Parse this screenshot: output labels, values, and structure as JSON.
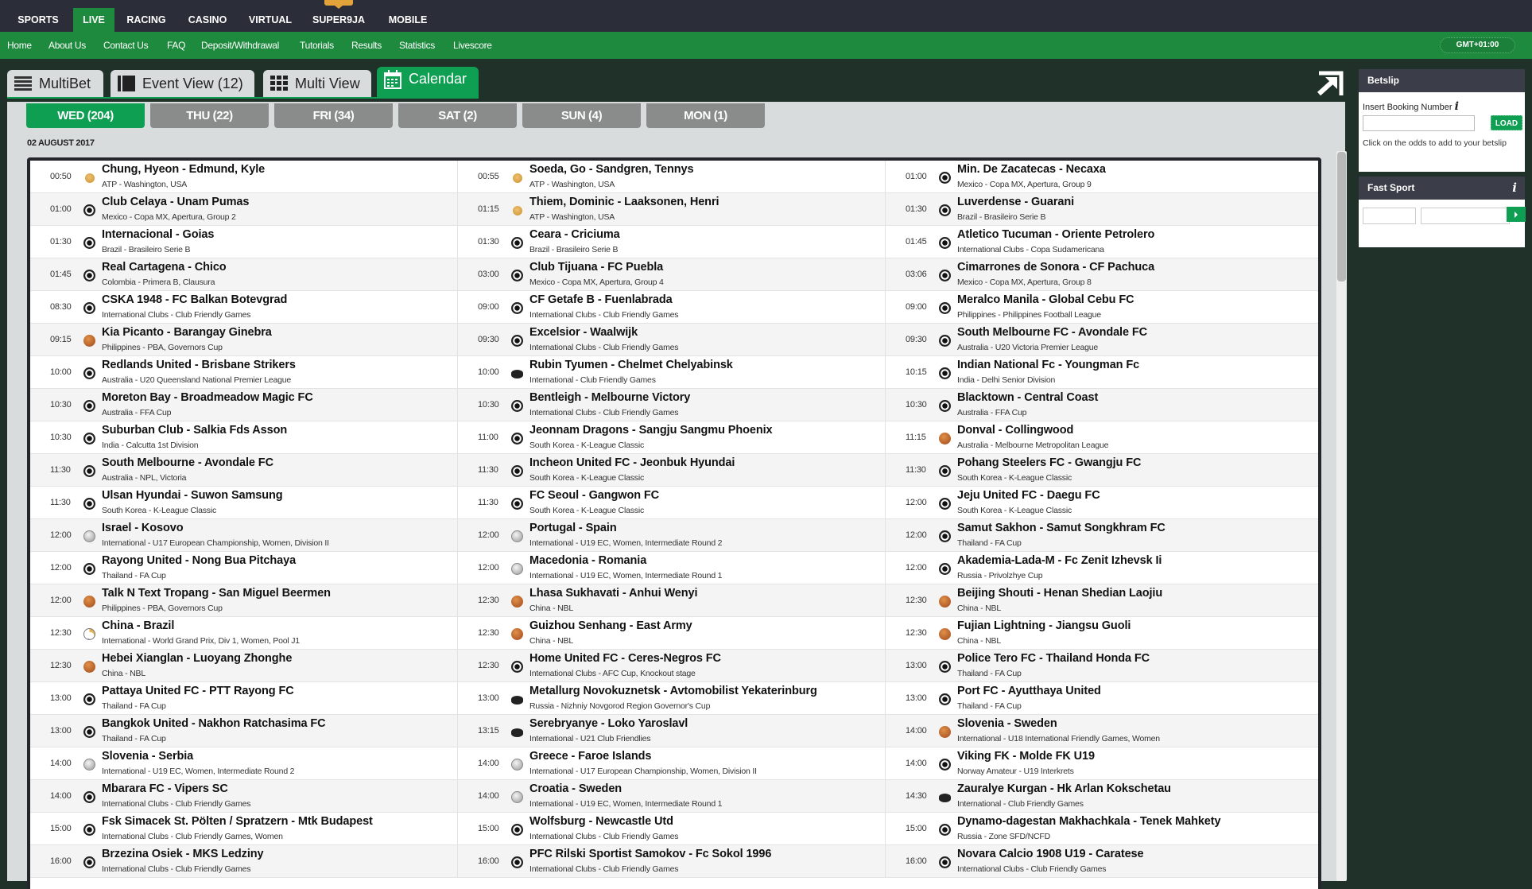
{
  "top_nav": [
    {
      "label": "SPORTS",
      "active": false
    },
    {
      "label": "LIVE",
      "active": true
    },
    {
      "label": "RACING",
      "active": false
    },
    {
      "label": "CASINO",
      "active": false
    },
    {
      "label": "VIRTUAL",
      "active": false
    },
    {
      "label": "SUPER9JA",
      "active": false
    },
    {
      "label": "MOBILE",
      "active": false
    }
  ],
  "sub_nav": [
    "Home",
    "About Us",
    "Contact Us",
    "FAQ",
    "Deposit/Withdrawal",
    "Tutorials",
    "Results",
    "Statistics",
    "Livescore"
  ],
  "timezone": "GMT+01:00",
  "view_tabs": [
    {
      "label": "MultiBet",
      "icon": "list-icon",
      "active": false
    },
    {
      "label": "Event View (12)",
      "icon": "sidebar-layout-icon",
      "active": false
    },
    {
      "label": "Multi View",
      "icon": "grid-icon",
      "active": false
    },
    {
      "label": "Calendar",
      "icon": "calendar-icon",
      "active": true
    }
  ],
  "day_tabs": [
    {
      "label": "WED (204)",
      "active": true
    },
    {
      "label": "THU (22)",
      "active": false
    },
    {
      "label": "FRI (34)",
      "active": false
    },
    {
      "label": "SAT (2)",
      "active": false
    },
    {
      "label": "SUN (4)",
      "active": false
    },
    {
      "label": "MON (1)",
      "active": false
    }
  ],
  "date_label": "02 AUGUST 2017",
  "columns": [
    [
      {
        "time": "00:50",
        "sport": "tennis",
        "match": "Chung, Hyeon - Edmund, Kyle",
        "competition": "ATP - Washington, USA"
      },
      {
        "time": "01:00",
        "sport": "soccer",
        "match": "Club Celaya - Unam Pumas",
        "competition": "Mexico - Copa MX, Apertura, Group 2"
      },
      {
        "time": "01:30",
        "sport": "soccer",
        "match": "Internacional - Goias",
        "competition": "Brazil - Brasileiro Serie B"
      },
      {
        "time": "01:45",
        "sport": "soccer",
        "match": "Real Cartagena - Chico",
        "competition": "Colombia - Primera B, Clausura"
      },
      {
        "time": "08:30",
        "sport": "soccer",
        "match": "CSKA 1948 - FC Balkan Botevgrad",
        "competition": "International Clubs - Club Friendly Games"
      },
      {
        "time": "09:15",
        "sport": "basketball",
        "match": "Kia Picanto - Barangay Ginebra",
        "competition": "Philippines - PBA, Governors Cup"
      },
      {
        "time": "10:00",
        "sport": "soccer",
        "match": "Redlands United - Brisbane Strikers",
        "competition": "Australia - U20 Queensland National Premier League"
      },
      {
        "time": "10:30",
        "sport": "soccer",
        "match": "Moreton Bay - Broadmeadow Magic FC",
        "competition": "Australia - FFA Cup"
      },
      {
        "time": "10:30",
        "sport": "soccer",
        "match": "Suburban Club - Salkia Fds Asson",
        "competition": "India - Calcutta 1st Division"
      },
      {
        "time": "11:30",
        "sport": "soccer",
        "match": "South Melbourne - Avondale FC",
        "competition": "Australia - NPL, Victoria"
      },
      {
        "time": "11:30",
        "sport": "soccer",
        "match": "Ulsan Hyundai - Suwon Samsung",
        "competition": "South Korea - K-League Classic"
      },
      {
        "time": "12:00",
        "sport": "handball",
        "match": "Israel - Kosovo",
        "competition": "International - U17 European Championship, Women, Division II"
      },
      {
        "time": "12:00",
        "sport": "soccer",
        "match": "Rayong United - Nong Bua Pitchaya",
        "competition": "Thailand - FA Cup"
      },
      {
        "time": "12:00",
        "sport": "basketball",
        "match": "Talk N Text Tropang - San Miguel Beermen",
        "competition": "Philippines - PBA, Governors Cup"
      },
      {
        "time": "12:30",
        "sport": "volleyball",
        "match": "China - Brazil",
        "competition": "International - World Grand Prix, Div 1, Women, Pool J1"
      },
      {
        "time": "12:30",
        "sport": "basketball",
        "match": "Hebei Xianglan - Luoyang Zhonghe",
        "competition": "China - NBL"
      },
      {
        "time": "13:00",
        "sport": "soccer",
        "match": "Pattaya United FC - PTT Rayong FC",
        "competition": "Thailand - FA Cup"
      },
      {
        "time": "13:00",
        "sport": "soccer",
        "match": "Bangkok United - Nakhon Ratchasima FC",
        "competition": "Thailand - FA Cup"
      },
      {
        "time": "14:00",
        "sport": "handball",
        "match": "Slovenia - Serbia",
        "competition": "International - U19 EC, Women, Intermediate Round 2"
      },
      {
        "time": "14:00",
        "sport": "soccer",
        "match": "Mbarara FC - Vipers SC",
        "competition": "International Clubs - Club Friendly Games"
      },
      {
        "time": "15:00",
        "sport": "soccer",
        "match": "Fsk Simacek St. Pölten / Spratzern - Mtk Budapest",
        "competition": "International Clubs - Club Friendly Games, Women"
      },
      {
        "time": "16:00",
        "sport": "soccer",
        "match": "Brzezina Osiek - MKS Ledziny",
        "competition": "International Clubs - Club Friendly Games"
      }
    ],
    [
      {
        "time": "00:55",
        "sport": "tennis",
        "match": "Soeda, Go - Sandgren, Tennys",
        "competition": "ATP - Washington, USA"
      },
      {
        "time": "01:15",
        "sport": "tennis",
        "match": "Thiem, Dominic - Laaksonen, Henri",
        "competition": "ATP - Washington, USA"
      },
      {
        "time": "01:30",
        "sport": "soccer",
        "match": "Ceara - Criciuma",
        "competition": "Brazil - Brasileiro Serie B"
      },
      {
        "time": "03:00",
        "sport": "soccer",
        "match": "Club Tijuana - FC Puebla",
        "competition": "Mexico - Copa MX, Apertura, Group 4"
      },
      {
        "time": "09:00",
        "sport": "soccer",
        "match": "CF Getafe B - Fuenlabrada",
        "competition": "International Clubs - Club Friendly Games"
      },
      {
        "time": "09:30",
        "sport": "soccer",
        "match": "Excelsior - Waalwijk",
        "competition": "International Clubs - Club Friendly Games"
      },
      {
        "time": "10:00",
        "sport": "ice-hockey",
        "match": "Rubin Tyumen - Chelmet Chelyabinsk",
        "competition": "International - Club Friendly Games"
      },
      {
        "time": "10:30",
        "sport": "soccer",
        "match": "Bentleigh - Melbourne Victory",
        "competition": "International Clubs - Club Friendly Games"
      },
      {
        "time": "11:00",
        "sport": "soccer",
        "match": "Jeonnam Dragons - Sangju Sangmu Phoenix",
        "competition": "South Korea - K-League Classic"
      },
      {
        "time": "11:30",
        "sport": "soccer",
        "match": "Incheon United FC - Jeonbuk Hyundai",
        "competition": "South Korea - K-League Classic"
      },
      {
        "time": "11:30",
        "sport": "soccer",
        "match": "FC Seoul - Gangwon FC",
        "competition": "South Korea - K-League Classic"
      },
      {
        "time": "12:00",
        "sport": "handball",
        "match": "Portugal - Spain",
        "competition": "International - U19 EC, Women, Intermediate Round 2"
      },
      {
        "time": "12:00",
        "sport": "handball",
        "match": "Macedonia - Romania",
        "competition": "International - U19 EC, Women, Intermediate Round 1"
      },
      {
        "time": "12:30",
        "sport": "basketball",
        "match": "Lhasa Sukhavati - Anhui Wenyi",
        "competition": "China - NBL"
      },
      {
        "time": "12:30",
        "sport": "basketball",
        "match": "Guizhou Senhang - East Army",
        "competition": "China - NBL"
      },
      {
        "time": "12:30",
        "sport": "soccer",
        "match": "Home United FC - Ceres-Negros FC",
        "competition": "International Clubs - AFC Cup, Knockout stage"
      },
      {
        "time": "13:00",
        "sport": "ice-hockey",
        "match": "Metallurg Novokuznetsk - Avtomobilist Yekaterinburg",
        "competition": "Russia - Nizhniy Novgorod Region Governor's Cup"
      },
      {
        "time": "13:15",
        "sport": "ice-hockey",
        "match": "Serebryanye - Loko Yaroslavl",
        "competition": "International - U21 Club Friendlies"
      },
      {
        "time": "14:00",
        "sport": "handball",
        "match": "Greece - Faroe Islands",
        "competition": "International - U17 European Championship, Women, Division II"
      },
      {
        "time": "14:00",
        "sport": "handball",
        "match": "Croatia - Sweden",
        "competition": "International - U19 EC, Women, Intermediate Round 1"
      },
      {
        "time": "15:00",
        "sport": "soccer",
        "match": "Wolfsburg - Newcastle Utd",
        "competition": "International Clubs - Club Friendly Games"
      },
      {
        "time": "16:00",
        "sport": "soccer",
        "match": "PFC Rilski Sportist Samokov - Fc Sokol 1996",
        "competition": "International Clubs - Club Friendly Games"
      }
    ],
    [
      {
        "time": "01:00",
        "sport": "soccer",
        "match": "Min. De Zacatecas - Necaxa",
        "competition": "Mexico - Copa MX, Apertura, Group 9"
      },
      {
        "time": "01:30",
        "sport": "soccer",
        "match": "Luverdense - Guarani",
        "competition": "Brazil - Brasileiro Serie B"
      },
      {
        "time": "01:45",
        "sport": "soccer",
        "match": "Atletico Tucuman - Oriente Petrolero",
        "competition": "International Clubs - Copa Sudamericana"
      },
      {
        "time": "03:06",
        "sport": "soccer",
        "match": "Cimarrones de Sonora - CF Pachuca",
        "competition": "Mexico - Copa MX, Apertura, Group 8"
      },
      {
        "time": "09:00",
        "sport": "soccer",
        "match": "Meralco Manila - Global Cebu FC",
        "competition": "Philippines - Philippines Football League"
      },
      {
        "time": "09:30",
        "sport": "soccer",
        "match": "South Melbourne FC - Avondale FC",
        "competition": "Australia - U20 Victoria Premier League"
      },
      {
        "time": "10:15",
        "sport": "soccer",
        "match": "Indian National Fc - Youngman Fc",
        "competition": "India - Delhi Senior Division"
      },
      {
        "time": "10:30",
        "sport": "soccer",
        "match": "Blacktown - Central Coast",
        "competition": "Australia - FFA Cup"
      },
      {
        "time": "11:15",
        "sport": "basketball",
        "match": "Donval - Collingwood",
        "competition": "Australia - Melbourne Metropolitan League"
      },
      {
        "time": "11:30",
        "sport": "soccer",
        "match": "Pohang Steelers FC - Gwangju FC",
        "competition": "South Korea - K-League Classic"
      },
      {
        "time": "12:00",
        "sport": "soccer",
        "match": "Jeju United FC - Daegu FC",
        "competition": "South Korea - K-League Classic"
      },
      {
        "time": "12:00",
        "sport": "soccer",
        "match": "Samut Sakhon - Samut Songkhram FC",
        "competition": "Thailand - FA Cup"
      },
      {
        "time": "12:00",
        "sport": "soccer",
        "match": "Akademia-Lada-M - Fc Zenit Izhevsk Ii",
        "competition": "Russia - Privolzhye Cup"
      },
      {
        "time": "12:30",
        "sport": "basketball",
        "match": "Beijing Shouti - Henan Shedian Laojiu",
        "competition": "China - NBL"
      },
      {
        "time": "12:30",
        "sport": "basketball",
        "match": "Fujian Lightning - Jiangsu Guoli",
        "competition": "China - NBL"
      },
      {
        "time": "13:00",
        "sport": "soccer",
        "match": "Police Tero FC - Thailand Honda FC",
        "competition": "Thailand - FA Cup"
      },
      {
        "time": "13:00",
        "sport": "soccer",
        "match": "Port FC - Ayutthaya United",
        "competition": "Thailand - FA Cup"
      },
      {
        "time": "14:00",
        "sport": "basketball",
        "match": "Slovenia - Sweden",
        "competition": "International - U18 International Friendly Games, Women"
      },
      {
        "time": "14:00",
        "sport": "soccer",
        "match": "Viking FK - Molde FK U19",
        "competition": "Norway Amateur - U19 Interkrets"
      },
      {
        "time": "14:30",
        "sport": "ice-hockey",
        "match": "Zauralye Kurgan - Hk Arlan Kokschetau",
        "competition": "International - Club Friendly Games"
      },
      {
        "time": "15:00",
        "sport": "soccer",
        "match": "Dynamo-dagestan Makhachkala - Tenek Mahkety",
        "competition": "Russia - Zone SFD/NCFD"
      },
      {
        "time": "16:00",
        "sport": "soccer",
        "match": "Novara Calcio 1908 U19 - Caratese",
        "competition": "International Clubs - Club Friendly Games"
      }
    ]
  ],
  "betslip": {
    "title": "Betslip",
    "booking_label": "Insert Booking Number",
    "booking_value": "",
    "load_label": "LOAD",
    "hint": "Click on the odds to add to your betslip"
  },
  "fast_sport": {
    "title": "Fast Sport",
    "input1_value": "",
    "input2_value": ""
  },
  "colors": {
    "brand_green": "#1e8a3e",
    "active_green": "#0e9f53",
    "top_bar": "#2b2d38",
    "page_bg": "#1f3129",
    "inactive_day_tab": "#8a8c8c"
  }
}
